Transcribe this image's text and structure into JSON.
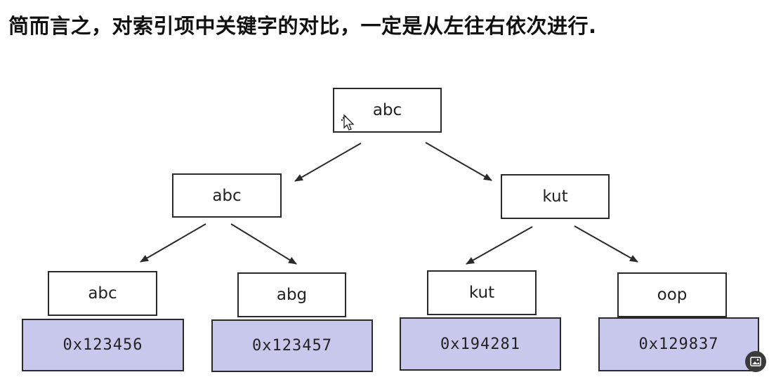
{
  "caption": "简而言之，对索引项中关键字的对比，一定是从左往右依次进行.",
  "colors": {
    "address_fill": "#c8c8ec",
    "node_fill": "#ffffff",
    "stroke": "#2a2a2a"
  },
  "tree": {
    "root": {
      "label": "abc"
    },
    "level1": [
      {
        "label": "abc"
      },
      {
        "label": "kut"
      }
    ],
    "leaves": [
      {
        "key": "abc",
        "address": "0x123456"
      },
      {
        "key": "abg",
        "address": "0x123457"
      },
      {
        "key": "kut",
        "address": "0x194281"
      },
      {
        "key": "oop",
        "address": "0x129837"
      }
    ]
  },
  "icons": {
    "cursor": "move-cursor-icon",
    "corner": "image-icon"
  }
}
